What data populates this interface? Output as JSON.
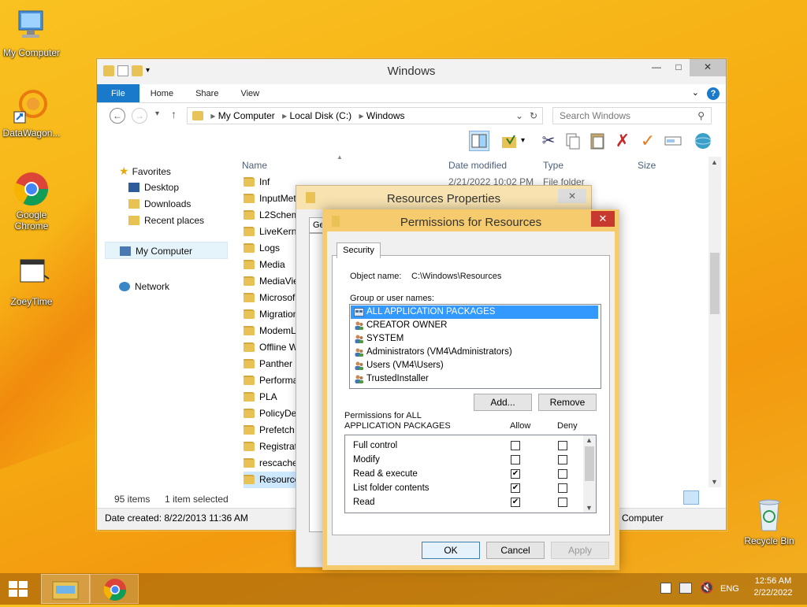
{
  "desktop": {
    "icons": [
      {
        "label": "My Computer"
      },
      {
        "label": "DataWagon..."
      },
      {
        "label": "Google Chrome"
      },
      {
        "label": "ZoeyTime"
      },
      {
        "label": "Recycle Bin"
      }
    ]
  },
  "explorer": {
    "title": "Windows",
    "tabs": [
      "File",
      "Home",
      "Share",
      "View"
    ],
    "address": [
      "My Computer",
      "Local Disk (C:)",
      "Windows"
    ],
    "search_placeholder": "Search Windows",
    "nav": {
      "favorites": "Favorites",
      "desktop": "Desktop",
      "downloads": "Downloads",
      "recent": "Recent places",
      "computer": "My Computer",
      "network": "Network"
    },
    "columns": {
      "name": "Name",
      "date": "Date modified",
      "type": "Type",
      "size": "Size"
    },
    "first_row": {
      "name": "Inf",
      "date": "2/21/2022 10:02 PM",
      "type": "File folder"
    },
    "files": [
      "InputMet",
      "L2Schem",
      "LiveKerne",
      "Logs",
      "Media",
      "MediaVie",
      "Microsof",
      "Migration",
      "ModemL",
      "Offline W",
      "Panther",
      "Performa",
      "PLA",
      "PolicyDef",
      "Prefetch",
      "Registrat",
      "rescache",
      "Resource"
    ],
    "status_count": "95 items",
    "status_selected": "1 item selected",
    "details": "Date created: 8/22/2013 11:36 AM",
    "details_right": "Computer"
  },
  "properties": {
    "title": "Resources Properties",
    "tab_partial": "Ge"
  },
  "permissions": {
    "title": "Permissions for Resources",
    "tab": "Security",
    "object_label": "Object name:",
    "object_value": "C:\\Windows\\Resources",
    "group_label": "Group or user names:",
    "users": [
      "ALL APPLICATION PACKAGES",
      "CREATOR OWNER",
      "SYSTEM",
      "Administrators (VM4\\Administrators)",
      "Users (VM4\\Users)",
      "TrustedInstaller"
    ],
    "add": "Add...",
    "remove": "Remove",
    "perm_for_line1": "Permissions for ALL",
    "perm_for_line2": "APPLICATION PACKAGES",
    "allow": "Allow",
    "deny": "Deny",
    "perms": [
      {
        "name": "Full control",
        "allow": false,
        "deny": false
      },
      {
        "name": "Modify",
        "allow": false,
        "deny": false
      },
      {
        "name": "Read & execute",
        "allow": true,
        "deny": false
      },
      {
        "name": "List folder contents",
        "allow": true,
        "deny": false
      },
      {
        "name": "Read",
        "allow": true,
        "deny": false
      }
    ],
    "ok": "OK",
    "cancel": "Cancel",
    "apply": "Apply"
  },
  "taskbar": {
    "lang": "ENG",
    "time": "12:56 AM",
    "date": "2/22/2022"
  },
  "colors": {
    "accent": "#1979ca",
    "selection": "#3399ff",
    "dialog_frame": "#f6cb6d"
  }
}
